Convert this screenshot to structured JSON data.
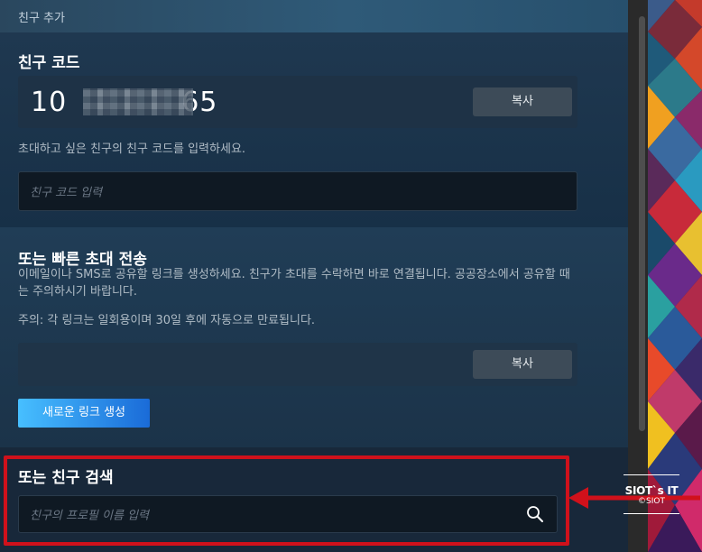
{
  "window": {
    "title": "친구 추가"
  },
  "friend_code": {
    "heading": "친구 코드",
    "code_prefix": "10",
    "code_suffix": "65",
    "copy_label": "복사",
    "prompt": "초대하고 싶은 친구의 친구 코드를 입력하세요.",
    "input_placeholder": "친구 코드 입력"
  },
  "quick_invite": {
    "heading": "또는 빠른 초대 전송",
    "description": "이메일이나 SMS로 공유할 링크를 생성하세요. 친구가 초대를 수락하면 바로 연결됩니다. 공공장소에서 공유할 때는 주의하시기 바랍니다.",
    "note": "주의: 각 링크는 일회용이며 30일 후에 자동으로 만료됩니다.",
    "copy_label": "복사",
    "generate_label": "새로운 링크 생성"
  },
  "search": {
    "heading": "또는 친구 검색",
    "input_placeholder": "친구의 프로필 이름 입력",
    "icon": "search-icon"
  },
  "watermark": {
    "line1": "SIOT`s IT",
    "line2": "©SIOT"
  },
  "colors": {
    "accent_blue_start": "#47bfff",
    "accent_blue_end": "#1a6bd8",
    "highlight_red": "#d0111b",
    "panel_bg": "#1b2838"
  }
}
